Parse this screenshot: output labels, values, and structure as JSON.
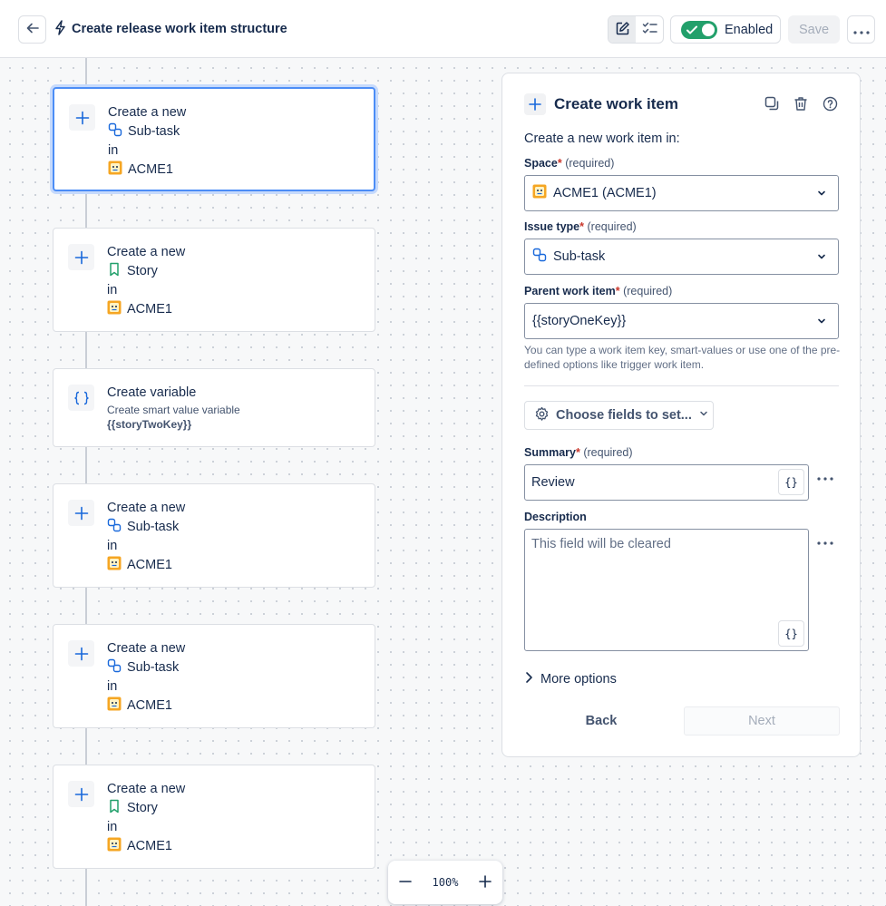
{
  "header": {
    "title": "Create release work item structure",
    "enabled_label": "Enabled",
    "save_label": "Save"
  },
  "nodes": [
    {
      "line1": "Create a new",
      "type": "Sub-task",
      "in": "in",
      "space": "ACME1"
    },
    {
      "line1": "Create a new",
      "type": "Story",
      "in": "in",
      "space": "ACME1"
    },
    {
      "title": "Create variable",
      "subtitle": "Create smart value variable",
      "key": "{{storyTwoKey}}"
    },
    {
      "line1": "Create a new",
      "type": "Sub-task",
      "in": "in",
      "space": "ACME1"
    },
    {
      "line1": "Create a new",
      "type": "Sub-task",
      "in": "in",
      "space": "ACME1"
    },
    {
      "line1": "Create a new",
      "type": "Story",
      "in": "in",
      "space": "ACME1"
    }
  ],
  "zoom": {
    "value": "100%"
  },
  "panel": {
    "title": "Create work item",
    "intro": "Create a new work item in:",
    "space": {
      "label": "Space",
      "required": "(required)",
      "value": "ACME1 (ACME1)"
    },
    "issue_type": {
      "label": "Issue type",
      "required": "(required)",
      "value": "Sub-task"
    },
    "parent": {
      "label": "Parent work item",
      "required": "(required)",
      "value": "{{storyOneKey}}",
      "helper": "You can type a work item key, smart-values or use one of the pre-defined options like trigger work item."
    },
    "choose_fields": "Choose fields to set...",
    "summary": {
      "label": "Summary",
      "required": "(required)",
      "value": "Review"
    },
    "description": {
      "label": "Description",
      "placeholder": "This field will be cleared"
    },
    "smart_value_glyph": "{}",
    "more_options": "More options",
    "back_label": "Back",
    "next_label": "Next"
  },
  "colors": {
    "accent": "#1868db",
    "enabled": "#22a06b",
    "selected_border": "#4c8df6",
    "required": "#c9372c"
  }
}
